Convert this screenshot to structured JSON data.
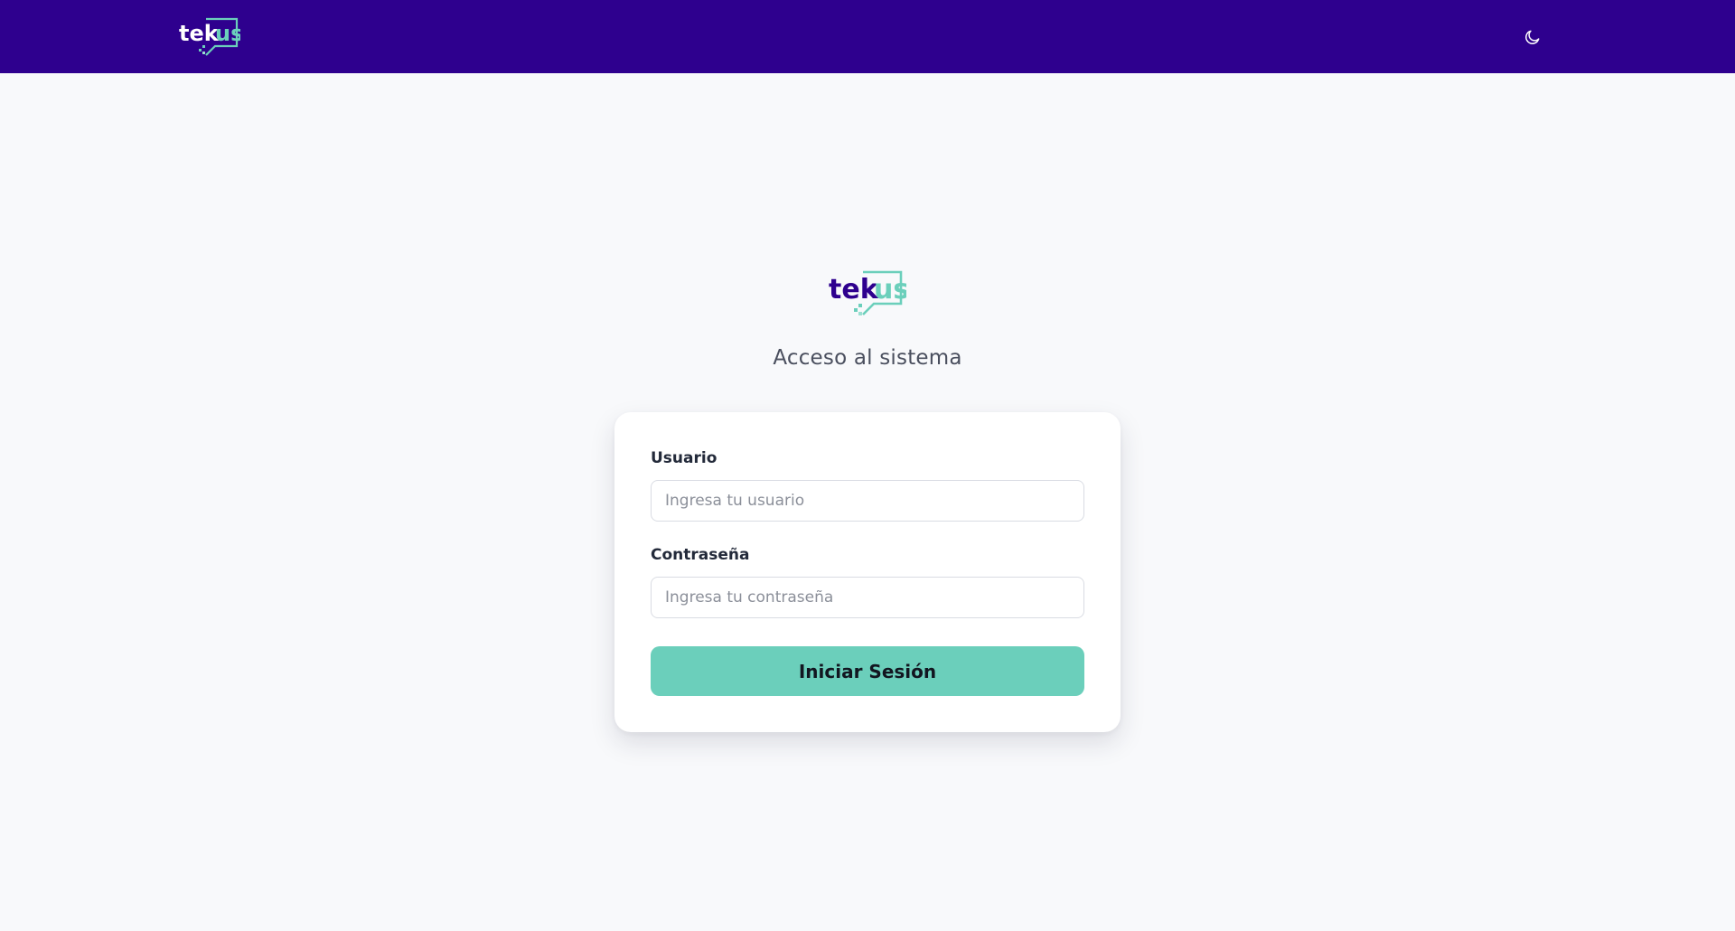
{
  "header": {
    "logo_text": "tekus",
    "theme_toggle_icon": "moon-icon",
    "background_color": "#2e008e"
  },
  "main": {
    "logo_text": "tekus",
    "subtitle": "Acceso al sistema"
  },
  "login_form": {
    "username_label": "Usuario",
    "username_placeholder": "Ingresa tu usuario",
    "username_value": "",
    "password_label": "Contraseña",
    "password_placeholder": "Ingresa tu contraseña",
    "password_value": "",
    "submit_label": "Iniciar Sesión"
  },
  "colors": {
    "brand_purple": "#2e008e",
    "brand_teal": "#6bcfbb",
    "page_background": "#f8f9fb"
  }
}
